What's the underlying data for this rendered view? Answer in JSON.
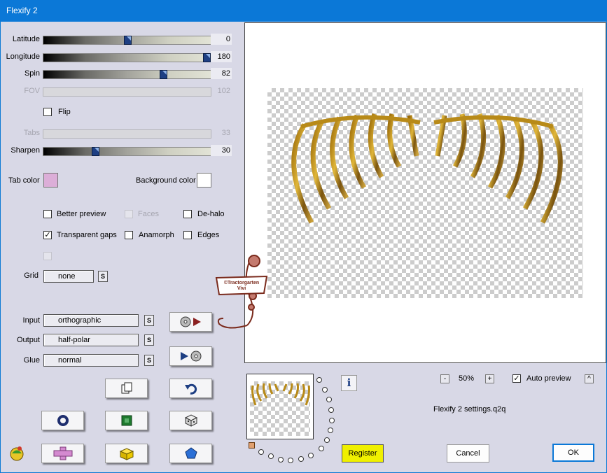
{
  "window": {
    "title": "Flexify 2"
  },
  "sliders": [
    {
      "label": "Latitude",
      "value": "0",
      "level": 0.5,
      "enabled": true
    },
    {
      "label": "Longitude",
      "value": "180",
      "level": 1.0,
      "enabled": true
    },
    {
      "label": "Spin",
      "value": "82",
      "level": 0.72,
      "enabled": true
    },
    {
      "label": "FOV",
      "value": "102",
      "level": null,
      "enabled": false
    }
  ],
  "flip": {
    "label": "Flip",
    "checked": false
  },
  "tabs_slider": {
    "label": "Tabs",
    "value": "33",
    "enabled": false
  },
  "sharpen": {
    "label": "Sharpen",
    "value": "30",
    "level": 0.3
  },
  "colors": {
    "tab_color_label": "Tab color",
    "tab_color": "#dcaed8",
    "background_color_label": "Background color",
    "background_color": "#ffffff"
  },
  "options": {
    "better_preview": {
      "label": "Better preview",
      "checked": false
    },
    "faces": {
      "label": "Faces",
      "checked": false,
      "enabled": false
    },
    "de_halo": {
      "label": "De-halo",
      "checked": false
    },
    "transparent_gaps": {
      "label": "Transparent gaps",
      "checked": true
    },
    "anamorph": {
      "label": "Anamorph",
      "checked": false
    },
    "edges": {
      "label": "Edges",
      "checked": false
    }
  },
  "grid": {
    "label": "Grid",
    "value": "none",
    "s_label": "S"
  },
  "projection": {
    "input_label": "Input",
    "input_value": "orthographic",
    "output_label": "Output",
    "output_value": "half-polar",
    "glue_label": "Glue",
    "glue_value": "normal",
    "s_label": "S"
  },
  "zoom": {
    "minus": "-",
    "value": "50%",
    "plus": "+"
  },
  "auto_preview": {
    "label": "Auto preview",
    "checked": true,
    "toggle": "^"
  },
  "settings_file": "Flexify 2 settings.q2q",
  "buttons": {
    "register": "Register",
    "cancel": "Cancel",
    "ok": "OK",
    "info": "i"
  },
  "watermark": {
    "text": "©Tractorgarten Vivi",
    "color": "#7a2a1c"
  },
  "accent": {
    "register_bg": "#f0f000",
    "titlebar": "#0b78d7",
    "thumb": "#1e3f83"
  }
}
